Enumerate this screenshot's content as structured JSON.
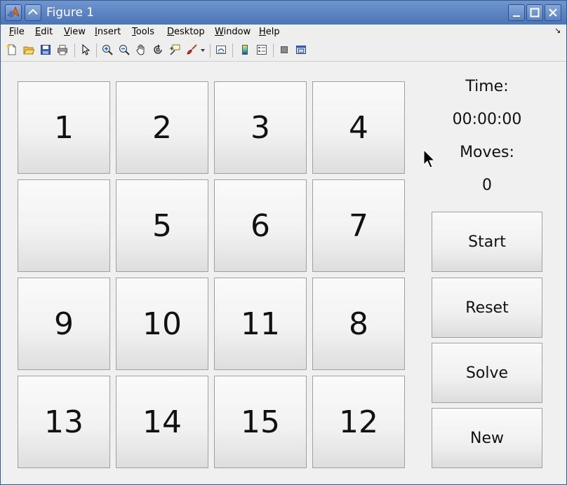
{
  "window": {
    "title": "Figure 1"
  },
  "menu": [
    {
      "pre": "",
      "ul": "F",
      "post": "ile"
    },
    {
      "pre": "",
      "ul": "E",
      "post": "dit"
    },
    {
      "pre": "",
      "ul": "V",
      "post": "iew"
    },
    {
      "pre": "",
      "ul": "I",
      "post": "nsert"
    },
    {
      "pre": "",
      "ul": "T",
      "post": "ools"
    },
    {
      "pre": "",
      "ul": "D",
      "post": "esktop"
    },
    {
      "pre": "",
      "ul": "W",
      "post": "indow"
    },
    {
      "pre": "",
      "ul": "H",
      "post": "elp"
    }
  ],
  "toolbar": {
    "icons": [
      "new-figure-icon",
      "open-file-icon",
      "save-icon",
      "print-icon",
      "pointer-icon",
      "zoom-in-icon",
      "zoom-out-icon",
      "pan-icon",
      "rotate-3d-icon",
      "data-cursor-icon",
      "brush-icon",
      "link-plot-icon",
      "colorbar-icon",
      "legend-icon",
      "hide-plot-tools-icon",
      "show-plot-tools-icon"
    ]
  },
  "puzzle": {
    "tiles": [
      "1",
      "2",
      "3",
      "4",
      "",
      "5",
      "6",
      "7",
      "9",
      "10",
      "11",
      "8",
      "13",
      "14",
      "15",
      "12"
    ]
  },
  "status": {
    "time_label": "Time:",
    "time_value": "00:00:00",
    "moves_label": "Moves:",
    "moves_value": "0"
  },
  "controls": {
    "start": "Start",
    "reset": "Reset",
    "solve": "Solve",
    "new": "New"
  }
}
